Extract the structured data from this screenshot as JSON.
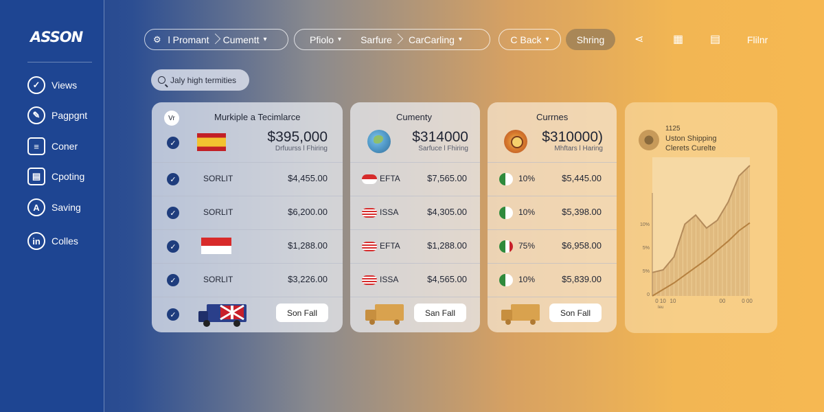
{
  "app": {
    "logo": "ASSON"
  },
  "sidebar": {
    "items": [
      {
        "label": "Views",
        "icon": "check-circle-icon"
      },
      {
        "label": "Pagpgnt",
        "icon": "pen-icon"
      },
      {
        "label": "Coner",
        "icon": "document-icon"
      },
      {
        "label": "Cpoting",
        "icon": "layers-icon"
      },
      {
        "label": "Saving",
        "icon": "a-circle-icon"
      },
      {
        "label": "Colles",
        "icon": "in-circle-icon"
      }
    ]
  },
  "topbar": {
    "group1": {
      "icon": "gear-icon",
      "seg1": "l Promant",
      "seg2": "Cumentt"
    },
    "group2": {
      "seg1": "Pfiolo",
      "seg2": "Sarfure",
      "seg3": "CarCarling"
    },
    "group3": {
      "seg1": "C Back"
    },
    "sharing_label": "Shring",
    "filter_label": "Flilnr",
    "tool_icons": [
      "share-icon",
      "grid-icon",
      "list-icon"
    ]
  },
  "search": {
    "placeholder": "Jaly high termities"
  },
  "cards": [
    {
      "badge": "Vr",
      "title": "Murkiple a Tecimlarce",
      "amount": "$395,000",
      "sub": "Drfuurss l Fhiring",
      "rows": [
        {
          "label": "SORLIT",
          "value": "$4,455.00"
        },
        {
          "label": "SORLIT",
          "value": "$6,200.00"
        },
        {
          "label": "",
          "value": "$1,288.00"
        },
        {
          "label": "SORLIT",
          "value": "$3,226.00"
        }
      ],
      "button": "Son Fall"
    },
    {
      "title": "Cumenty",
      "amount": "$314000",
      "sub": "Sarfuce l Fhiring",
      "rows": [
        {
          "label": "EFTA",
          "value": "$7,565.00"
        },
        {
          "label": "ISSA",
          "value": "$4,305.00"
        },
        {
          "label": "EFTA",
          "value": "$1,288.00"
        },
        {
          "label": "ISSA",
          "value": "$4,565.00"
        }
      ],
      "button": "San Fall"
    },
    {
      "title": "Currnes",
      "amount": "$310000)",
      "sub": "Mhftars l Haring",
      "rows": [
        {
          "label": "10%",
          "value": "$5,445.00"
        },
        {
          "label": "10%",
          "value": "$5,398.00"
        },
        {
          "label": "75%",
          "value": "$6,958.00"
        },
        {
          "label": "10%",
          "value": "$5,839.00"
        }
      ],
      "button": "Son Fall"
    }
  ],
  "chart_panel": {
    "value": "1125",
    "title": "Uston Shipping",
    "subtitle": "Clerets Curelte",
    "y_ticks": [
      "10%",
      "5%",
      "5%",
      "0"
    ],
    "x_ticks": [
      "0 10",
      "10",
      "00",
      "0 00"
    ],
    "x_caption": "Ieu"
  },
  "chart_data": {
    "type": "area",
    "title": "Uston Shipping",
    "series": [
      {
        "values": [
          0.18,
          0.2,
          0.3,
          0.55,
          0.62,
          0.52,
          0.58,
          0.72,
          0.92,
          1.0
        ]
      },
      {
        "values": [
          0.0,
          0.05,
          0.1,
          0.16,
          0.22,
          0.28,
          0.35,
          0.42,
          0.5,
          0.56
        ]
      }
    ],
    "grid": false
  }
}
